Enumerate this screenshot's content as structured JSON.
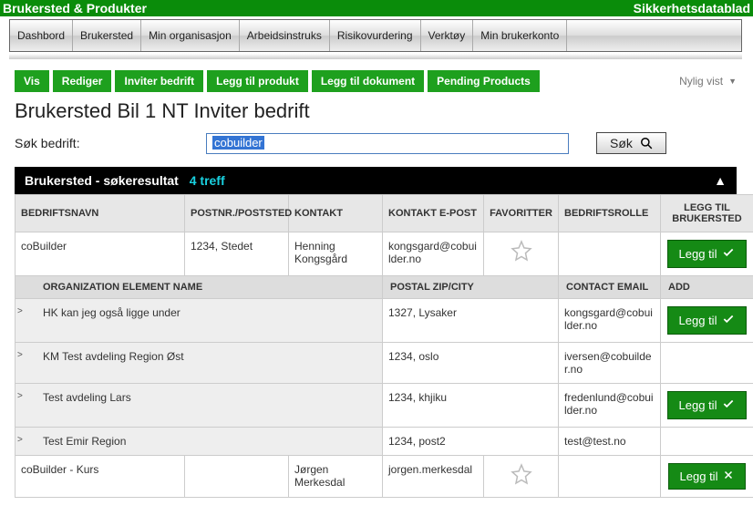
{
  "topbar": {
    "left": "Brukersted & Produkter",
    "right": "Sikkerhetsdatablad"
  },
  "menu": [
    "Dashbord",
    "Brukersted",
    "Min organisasjon",
    "Arbeidsinstruks",
    "Risikovurdering",
    "Verktøy",
    "Min brukerkonto"
  ],
  "actions": [
    "Vis",
    "Rediger",
    "Inviter bedrift",
    "Legg til produkt",
    "Legg til dokument",
    "Pending Products"
  ],
  "recent": "Nylig vist",
  "title": "Brukersted Bil 1 NT Inviter bedrift",
  "search": {
    "label": "Søk bedrift:",
    "value": "cobuilder",
    "btn": "Søk"
  },
  "results": {
    "title": "Brukersted - søkeresultat",
    "hits": "4 treff"
  },
  "columns": {
    "company": "BEDRIFTSNAVN",
    "postal": "POSTNR./POSTSTED",
    "contact": "KONTAKT",
    "email": "KONTAKT E-POST",
    "favorites": "FAVORITTER",
    "role": "BEDRIFTSROLLE",
    "add": "LEGG TIL BRUKERSTED"
  },
  "sub_columns": {
    "org": "ORGANIZATION ELEMENT NAME",
    "postal": "POSTAL ZIP/CITY",
    "email": "CONTACT EMAIL",
    "add": "ADD"
  },
  "add_label": "Legg til",
  "rows": [
    {
      "name": "coBuilder",
      "postal": "1234, Stedet",
      "contact": "Henning Kongsgård",
      "email": "kongsgard@cobuilder.no",
      "fav": true,
      "add": true
    }
  ],
  "sub_rows": [
    {
      "name": "HK kan jeg også ligge under",
      "postal": "1327, Lysaker",
      "email": "kongsgard@cobuilder.no",
      "add": true
    },
    {
      "name": "KM Test avdeling Region Øst",
      "postal": "1234, oslo",
      "email": "iversen@cobuilder.no",
      "add": false
    },
    {
      "name": "Test avdeling Lars",
      "postal": "1234, khjiku",
      "email": "fredenlund@cobuilder.no",
      "add": true
    },
    {
      "name": "Test Emir Region",
      "postal": "1234, post2",
      "email": "test@test.no",
      "add": false
    }
  ],
  "rows2": [
    {
      "name": "coBuilder - Kurs",
      "postal": "",
      "contact": "Jørgen Merkesdal",
      "email": "jorgen.merkesdal",
      "fav": true,
      "addx": true
    }
  ]
}
